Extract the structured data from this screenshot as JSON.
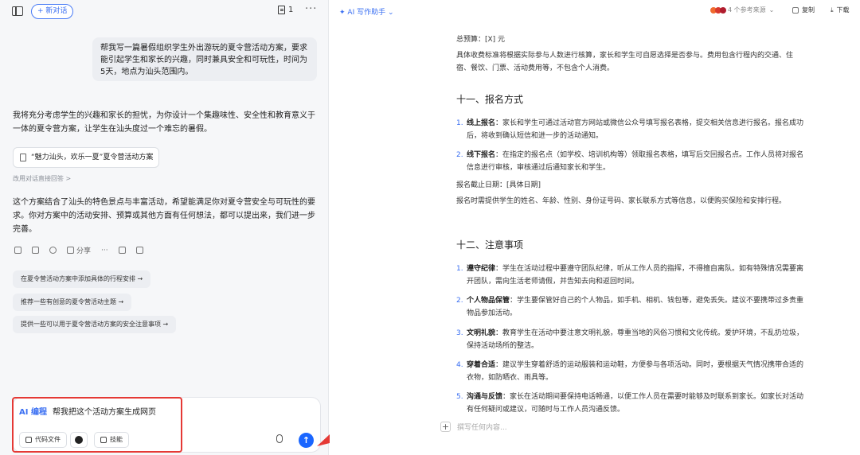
{
  "header": {
    "new_chat": "+ 新对话",
    "doc_count": "1",
    "more": "···"
  },
  "chat": {
    "user_message": "帮我写一篇暑假组织学生外出游玩的夏令营活动方案，要求能引起学生和家长的兴趣，同时兼具安全和可玩性，时间为5天，地点为汕头范围内。",
    "reply_intro": "我将充分考虑学生的兴趣和家长的担忧，为你设计一个集趣味性、安全性和教育意义于一体的夏令营方案，让学生在汕头度过一个难忘的暑假。",
    "file_card": "“魅力汕头，欢乐一夏”夏令营活动方案",
    "direct_link": "改用对话直接回答 >",
    "reply_outro": "这个方案结合了汕头的特色景点与丰富活动，希望能满足你对夏令营安全与可玩性的要求。你对方案中的活动安排、预算或其他方面有任何想法，都可以提出来，我们进一步完善。",
    "share": "分享",
    "suggestions": [
      "在夏令营活动方案中添加具体的行程安排 →",
      "推荐一些有创意的夏令营活动主题 →",
      "提供一些可以用于夏令营活动方案的安全注意事项 →"
    ]
  },
  "input": {
    "tag": "AI 编程",
    "text": "帮我把这个活动方案生成网页",
    "code_file": "代码文件",
    "skills": "技能"
  },
  "doc_header": {
    "ai_writer": "AI 写作助手",
    "refs": "4 个参考来源",
    "copy": "复制",
    "download": "下载"
  },
  "doc": {
    "budget": "总预算：[X] 元",
    "budget_desc": "具体收费标准将根据实际参与人数进行核算，家长和学生可自愿选择是否参与。费用包含行程内的交通、住宿、餐饮、门票、活动费用等，不包含个人消费。",
    "sec11": "十一、报名方式",
    "reg_items": [
      {
        "num": "1.",
        "title": "线上报名",
        "text": "：家长和学生可通过活动官方网站或微信公众号填写报名表格，提交相关信息进行报名。报名成功后，将收到确认短信和进一步的活动通知。"
      },
      {
        "num": "2.",
        "title": "线下报名",
        "text": "：在指定的报名点（如学校、培训机构等）领取报名表格，填写后交回报名点。工作人员将对报名信息进行审核，审核通过后通知家长和学生。"
      }
    ],
    "deadline": "报名截止日期：[具体日期]",
    "reg_note": "报名时需提供学生的姓名、年龄、性别、身份证号码、家长联系方式等信息，以便购买保险和安排行程。",
    "sec12": "十二、注意事项",
    "notes": [
      {
        "num": "1.",
        "title": "遵守纪律",
        "text": "：学生在活动过程中要遵守团队纪律，听从工作人员的指挥，不得擅自离队。如有特殊情况需要离开团队，需向生活老师请假，并告知去向和返回时间。"
      },
      {
        "num": "2.",
        "title": "个人物品保管",
        "text": "：学生要保管好自己的个人物品，如手机、相机、钱包等，避免丢失。建议不要携带过多贵重物品参加活动。"
      },
      {
        "num": "3.",
        "title": "文明礼貌",
        "text": "：教育学生在活动中要注意文明礼貌，尊重当地的风俗习惯和文化传统。爱护环境，不乱扔垃圾，保持活动场所的整洁。"
      },
      {
        "num": "4.",
        "title": "穿着合适",
        "text": "：建议学生穿着舒适的运动服装和运动鞋，方便参与各项活动。同时，要根据天气情况携带合适的衣物，如防晒衣、雨具等。"
      },
      {
        "num": "5.",
        "title": "沟通与反馈",
        "text": "：家长在活动期间要保持电话畅通，以便工作人员在需要时能够及时联系到家长。如家长对活动有任何疑问或建议，可随时与工作人员沟通反馈。"
      }
    ],
    "placeholder": "撰写任何内容..."
  },
  "colors": {
    "accent": "#3a6ff2",
    "send": "#1a66ff",
    "annotation": "#e53935"
  }
}
